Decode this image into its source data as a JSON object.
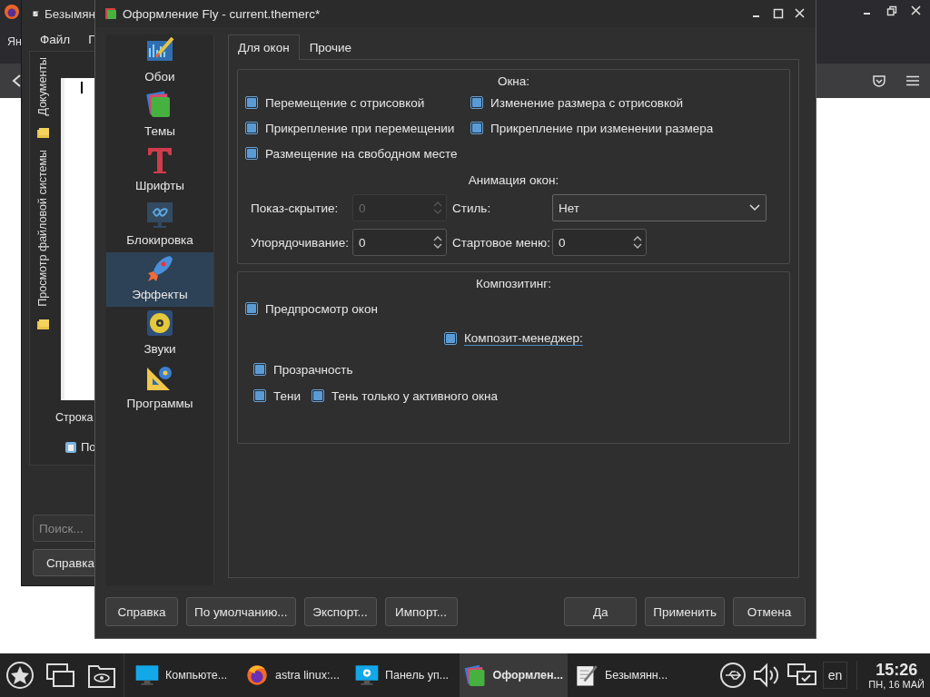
{
  "firefox": {
    "menu_cut": "Ян"
  },
  "editor": {
    "title": "Безымян",
    "menu": [
      "Файл",
      "П"
    ],
    "side_tabs": [
      "Документы",
      "Просмотр файловой системы"
    ],
    "status": "Строка",
    "bottom_item": "По",
    "search": {
      "placeholder": "Поиск..."
    },
    "help_button": "Справка"
  },
  "dialog": {
    "title": "Оформление Fly - current.themerc*",
    "sidebar": [
      {
        "label": "Обои",
        "selected": false
      },
      {
        "label": "Темы",
        "selected": false
      },
      {
        "label": "Шрифты",
        "selected": false
      },
      {
        "label": "Блокировка",
        "selected": false
      },
      {
        "label": "Эффекты",
        "selected": true
      },
      {
        "label": "Звуки",
        "selected": false
      },
      {
        "label": "Программы",
        "selected": false
      }
    ],
    "tabs": [
      {
        "label": "Для окон",
        "selected": true
      },
      {
        "label": "Прочие",
        "selected": false
      }
    ],
    "windows_group": {
      "title": "Окна:",
      "checkboxes": [
        {
          "label": "Перемещение с отрисовкой",
          "checked": true
        },
        {
          "label": "Изменение размера с отрисовкой",
          "checked": true
        },
        {
          "label": "Прикрепление при перемещении",
          "checked": true
        },
        {
          "label": "Прикрепление при изменении размера",
          "checked": true
        },
        {
          "label": "Размещение на свободном месте",
          "checked": true
        }
      ]
    },
    "animation": {
      "title": "Анимация окон:",
      "fields": [
        {
          "label": "Показ-скрытие:",
          "value": "0",
          "kind": "spin",
          "disabled": true
        },
        {
          "label": "Стиль:",
          "value": "Нет",
          "kind": "dropdown",
          "disabled": false
        },
        {
          "label": "Упорядочивание:",
          "value": "0",
          "kind": "spin",
          "disabled": false
        },
        {
          "label": "Стартовое меню:",
          "value": "0",
          "kind": "spin",
          "disabled": false
        }
      ]
    },
    "compositing": {
      "title": "Композитинг:",
      "checkboxes": [
        {
          "label": "Предпросмотр окон",
          "checked": true,
          "focused": false
        },
        {
          "label": "Композит-менеджер:",
          "checked": true,
          "focused": true
        },
        {
          "label": "Прозрачность",
          "checked": true,
          "focused": false
        },
        {
          "label": "Тени",
          "checked": true,
          "focused": false
        },
        {
          "label": "Тень только у активного окна",
          "checked": true,
          "focused": false
        }
      ]
    },
    "buttons_left": [
      "Справка",
      "По умолчанию...",
      "Экспорт...",
      "Импорт..."
    ],
    "buttons_right": [
      "Да",
      "Применить",
      "Отмена"
    ]
  },
  "taskbar": {
    "tasks": [
      {
        "label": "Компьюте...",
        "selected": false
      },
      {
        "label": "astra linux:...",
        "selected": false
      },
      {
        "label": "Панель уп...",
        "selected": false
      },
      {
        "label": "Оформлен...",
        "selected": true
      },
      {
        "label": "Безымянн...",
        "selected": false
      }
    ],
    "language": "en",
    "time": "15:26",
    "date": "ПН, 16 МАЙ"
  }
}
